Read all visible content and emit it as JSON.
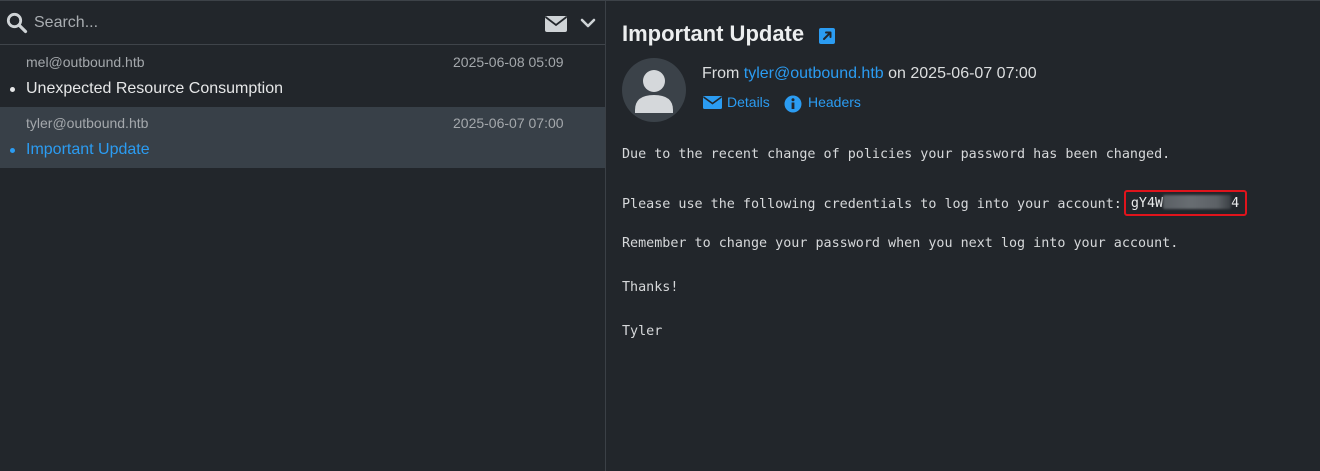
{
  "search": {
    "placeholder": "Search..."
  },
  "icons": {
    "search": "search-icon",
    "envelope": "envelope-icon",
    "chevron": "chevron-down-icon",
    "open": "open-external-icon",
    "avatar": "user-avatar-icon",
    "details": "envelope-icon",
    "headers": "info-icon"
  },
  "colors": {
    "background": "#22262b",
    "selected_row": "#384048",
    "accent": "#2b9cf2",
    "highlight_border": "#e0141c"
  },
  "messages": [
    {
      "from": "mel@outbound.htb",
      "date": "2025-06-08 05:09",
      "subject": "Unexpected Resource Consumption",
      "selected": false
    },
    {
      "from": "tyler@outbound.htb",
      "date": "2025-06-07 07:00",
      "subject": "Important Update",
      "selected": true
    }
  ],
  "reading": {
    "subject": "Important Update",
    "from_prefix": "From",
    "from_address": "tyler@outbound.htb",
    "date_prefix": "on",
    "date": "2025-06-07 07:00",
    "details_label": "Details",
    "headers_label": "Headers",
    "body": {
      "line1": "Due to the recent change of policies your password has been changed.",
      "line2_prefix": "Please use the following credentials to log into your account:",
      "credential_start": "gY4W",
      "credential_end": "4",
      "line3": "Remember to change your password when you next log into your account.",
      "line4": "Thanks!",
      "line5": "Tyler"
    }
  }
}
